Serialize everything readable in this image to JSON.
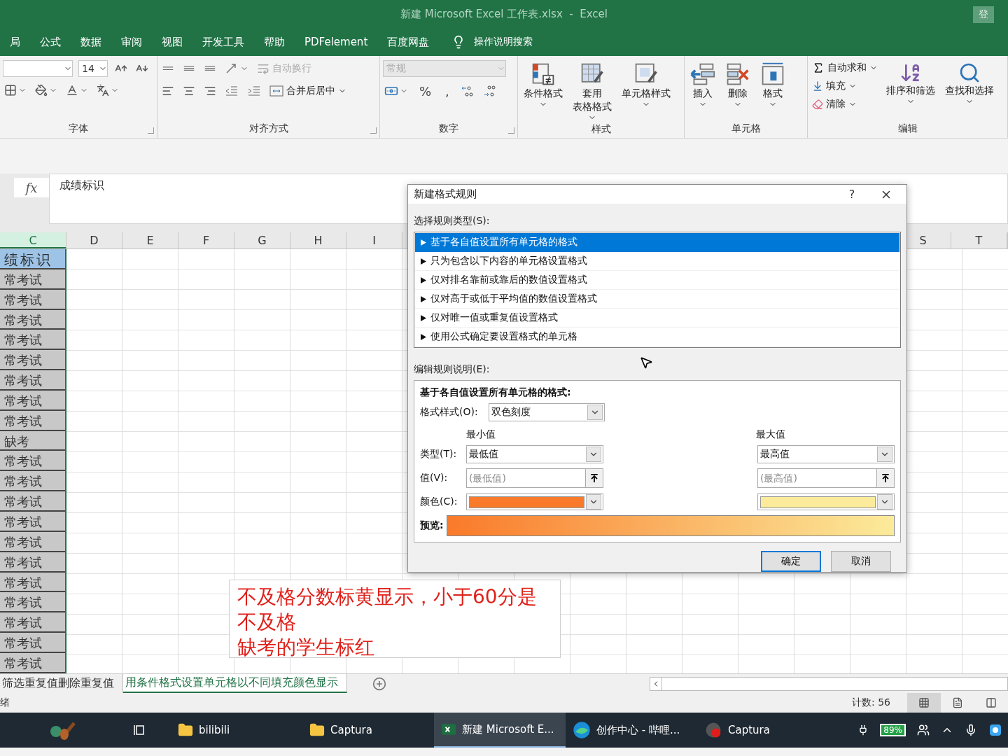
{
  "window": {
    "title": "新建 Microsoft Excel 工作表.xlsx  -  Excel",
    "account_button": "登"
  },
  "menu_tabs": [
    {
      "label": "局",
      "selected": false
    },
    {
      "label": "公式",
      "selected": false
    },
    {
      "label": "数据",
      "selected": false
    },
    {
      "label": "审阅",
      "selected": false
    },
    {
      "label": "视图",
      "selected": false
    },
    {
      "label": "开发工具",
      "selected": false
    },
    {
      "label": "帮助",
      "selected": false
    },
    {
      "label": "PDFelement",
      "selected": false
    },
    {
      "label": "百度网盘",
      "selected": false
    }
  ],
  "tell_me": "操作说明搜索",
  "ribbon": {
    "font": {
      "label": "字体",
      "font_size": "14"
    },
    "alignment": {
      "label": "对齐方式",
      "wrap_text": {
        "label": "自动换行",
        "disabled": true
      },
      "merge": "合并后居中"
    },
    "number": {
      "label": "数字",
      "format": {
        "value": "常规",
        "disabled": true
      },
      "percent": "%",
      "comma": ","
    },
    "styles": {
      "label": "样式",
      "buttons": [
        {
          "lines": [
            "条件格式"
          ]
        },
        {
          "lines": [
            "套用",
            "表格格式"
          ]
        },
        {
          "lines": [
            "单元格样式"
          ]
        }
      ]
    },
    "cells": {
      "label": "单元格",
      "buttons": [
        "插入",
        "删除",
        "格式"
      ]
    },
    "editing": {
      "label": "编辑",
      "small": [
        "自动求和",
        "填充",
        "清除"
      ],
      "large": [
        "排序和筛选",
        "查找和选择"
      ]
    }
  },
  "formula_bar": {
    "fx": "fx",
    "value": "成绩标识"
  },
  "sheet": {
    "columns_left": [
      {
        "label": "C",
        "selected": true
      },
      {
        "label": "D",
        "selected": false
      },
      {
        "label": "E",
        "selected": false
      },
      {
        "label": "F",
        "selected": false
      },
      {
        "label": "G",
        "selected": false
      },
      {
        "label": "H",
        "selected": false
      },
      {
        "label": "I",
        "selected": false
      }
    ],
    "columns_right": [
      {
        "label": "S",
        "selected": false
      },
      {
        "label": "T",
        "selected": false
      }
    ],
    "column_c": [
      {
        "text": "绩标识",
        "kind": "header"
      },
      {
        "text": "常考试",
        "kind": "data"
      },
      {
        "text": "常考试",
        "kind": "data"
      },
      {
        "text": "常考试",
        "kind": "data"
      },
      {
        "text": "常考试",
        "kind": "data"
      },
      {
        "text": "常考试",
        "kind": "data"
      },
      {
        "text": "常考试",
        "kind": "data"
      },
      {
        "text": "常考试",
        "kind": "data"
      },
      {
        "text": "常考试",
        "kind": "data"
      },
      {
        "text": "缺考",
        "kind": "data"
      },
      {
        "text": "常考试",
        "kind": "data"
      },
      {
        "text": "常考试",
        "kind": "data"
      },
      {
        "text": "常考试",
        "kind": "data"
      },
      {
        "text": "常考试",
        "kind": "data"
      },
      {
        "text": "常考试",
        "kind": "data"
      },
      {
        "text": "常考试",
        "kind": "data"
      },
      {
        "text": "常考试",
        "kind": "data"
      },
      {
        "text": "常考试",
        "kind": "data"
      },
      {
        "text": "常考试",
        "kind": "data"
      },
      {
        "text": "常考试",
        "kind": "data"
      },
      {
        "text": "常考试",
        "kind": "data"
      }
    ]
  },
  "note": {
    "lines": [
      "不及格分数标黄显示，小于60分是不及格",
      "缺考的学生标红"
    ]
  },
  "sheet_tabs": [
    {
      "label": "筛选重复值删除重复值",
      "selected": false
    },
    {
      "label": "用条件格式设置单元格以不同填充颜色显示",
      "selected": true
    }
  ],
  "status_bar": {
    "status": "绪",
    "count": "计数: 56",
    "views": [
      {
        "kind": "normal",
        "selected": true
      },
      {
        "kind": "page_layout",
        "selected": false
      },
      {
        "kind": "page_break",
        "selected": false
      }
    ]
  },
  "taskbar": {
    "items": [
      {
        "kind": "task_view",
        "selected": false
      },
      {
        "kind": "folder",
        "label": "bilibili",
        "selected": false
      },
      {
        "kind": "folder",
        "label": "Captura",
        "selected": false
      },
      {
        "kind": "excel",
        "label": "新建 Microsoft E...",
        "selected": true
      },
      {
        "kind": "edge",
        "label": "创作中心 - 哔哩...",
        "selected": false
      },
      {
        "kind": "record",
        "label": "Captura",
        "selected": false
      }
    ],
    "battery": "89%"
  },
  "dialog": {
    "title": "新建格式规则",
    "help": "?",
    "type_label": "选择规则类型(S):",
    "rule_types": [
      {
        "label": "基于各自值设置所有单元格的格式",
        "selected": true
      },
      {
        "label": "只为包含以下内容的单元格设置格式",
        "selected": false
      },
      {
        "label": "仅对排名靠前或靠后的数值设置格式",
        "selected": false
      },
      {
        "label": "仅对高于或低于平均值的数值设置格式",
        "selected": false
      },
      {
        "label": "仅对唯一值或重复值设置格式",
        "selected": false
      },
      {
        "label": "使用公式确定要设置格式的单元格",
        "selected": false
      }
    ],
    "description_label": "编辑规则说明(E):",
    "description_title": "基于各自值设置所有单元格的格式:",
    "style_label": "格式样式(O):",
    "style_value": "双色刻度",
    "min": {
      "heading": "最小值",
      "type": "最低值",
      "placeholder": "(最低值)",
      "color": "#f97a2a"
    },
    "max": {
      "heading": "最大值",
      "type": "最高值",
      "placeholder": "(最高值)",
      "color": "#fbeb9b"
    },
    "type_row_label": "类型(T):",
    "value_row_label": "值(V):",
    "color_row_label": "颜色(C):",
    "preview_label": "预览:",
    "ok": "确定",
    "cancel": "取消"
  }
}
